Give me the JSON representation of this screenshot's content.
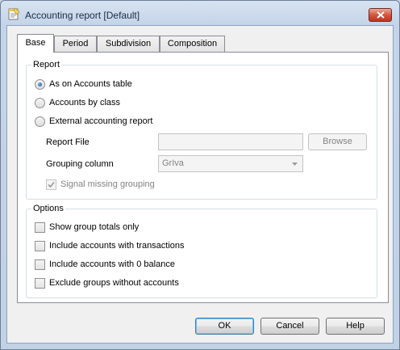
{
  "window": {
    "title": "Accounting report [Default]"
  },
  "tabs": [
    {
      "label": "Base",
      "active": true
    },
    {
      "label": "Period",
      "active": false
    },
    {
      "label": "Subdivision",
      "active": false
    },
    {
      "label": "Composition",
      "active": false
    }
  ],
  "report": {
    "group_title": "Report",
    "radios": [
      {
        "label": "As on Accounts table",
        "checked": true
      },
      {
        "label": "Accounts by class",
        "checked": false
      },
      {
        "label": "External accounting report",
        "checked": false
      }
    ],
    "report_file_label": "Report File",
    "report_file_value": "",
    "browse_label": "Browse",
    "grouping_column_label": "Grouping column",
    "grouping_column_value": "GrIva",
    "signal_missing_label": "Signal missing grouping",
    "signal_missing_checked": true
  },
  "options": {
    "group_title": "Options",
    "items": [
      {
        "label": "Show group totals only",
        "checked": false
      },
      {
        "label": "Include accounts with transactions",
        "checked": false
      },
      {
        "label": "Include accounts with 0 balance",
        "checked": false
      },
      {
        "label": "Exclude groups without accounts",
        "checked": false
      }
    ]
  },
  "buttons": {
    "ok": "OK",
    "cancel": "Cancel",
    "help": "Help"
  },
  "colors": {
    "title_bar": "#c4d4e8",
    "close_button": "#c2331b",
    "radio_dot": "#1b4f92"
  }
}
